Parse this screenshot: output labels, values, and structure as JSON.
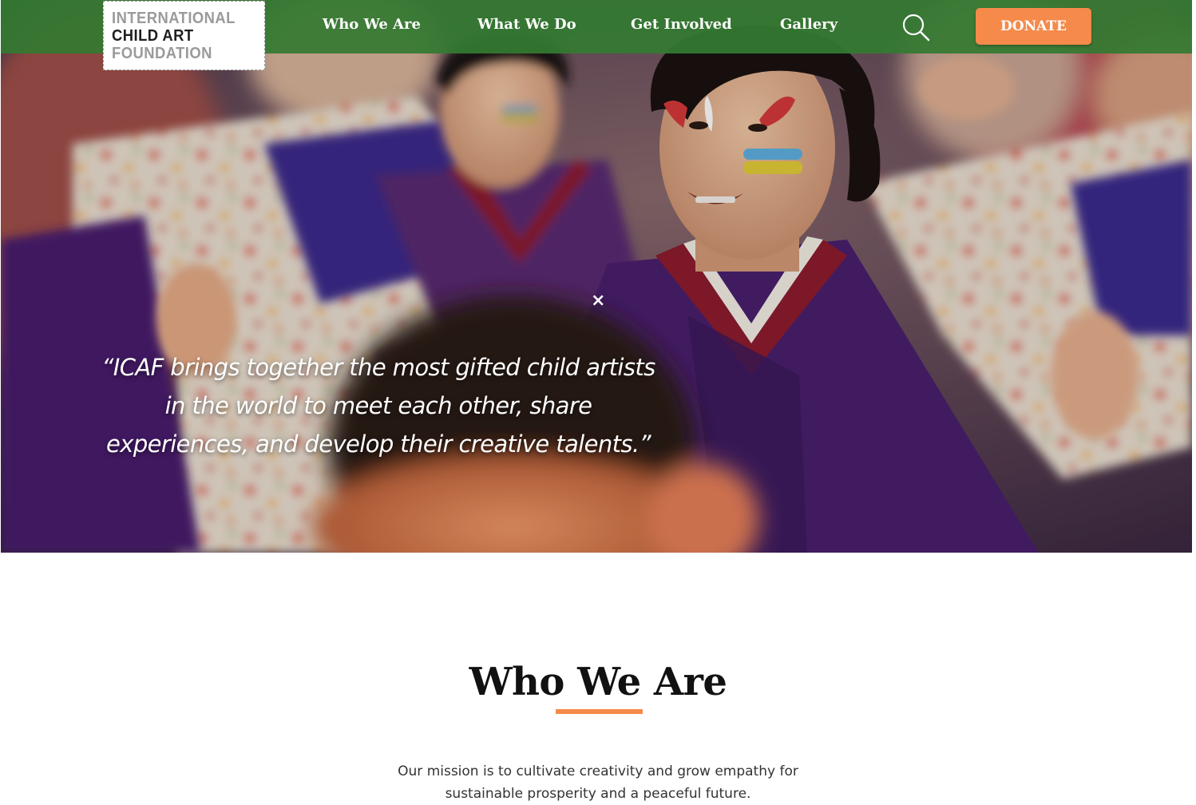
{
  "header": {
    "logo": {
      "line1": "INTERNATIONAL",
      "line2": "CHILD ART",
      "line3": "FOUNDATION"
    },
    "nav": [
      {
        "label": "Who We Are"
      },
      {
        "label": "What We Do"
      },
      {
        "label": "Get Involved"
      },
      {
        "label": "Gallery"
      }
    ],
    "search_icon": "search-icon",
    "donate_label": "DONATE"
  },
  "hero": {
    "close_symbol": "×",
    "quote": "“ICAF brings together the most gifted child artists in the world to meet each other, share experiences, and develop their creative talents.”"
  },
  "who_we_are": {
    "title": "Who We Are",
    "mission": "Our mission is to cultivate creativity and grow empathy for sustainable prosperity and a peaceful future."
  },
  "colors": {
    "nav_green": "#347a32",
    "accent_orange": "#f58a4b",
    "kimono_purple": "#4a1f6e",
    "collar_red": "#8e1c2e"
  }
}
